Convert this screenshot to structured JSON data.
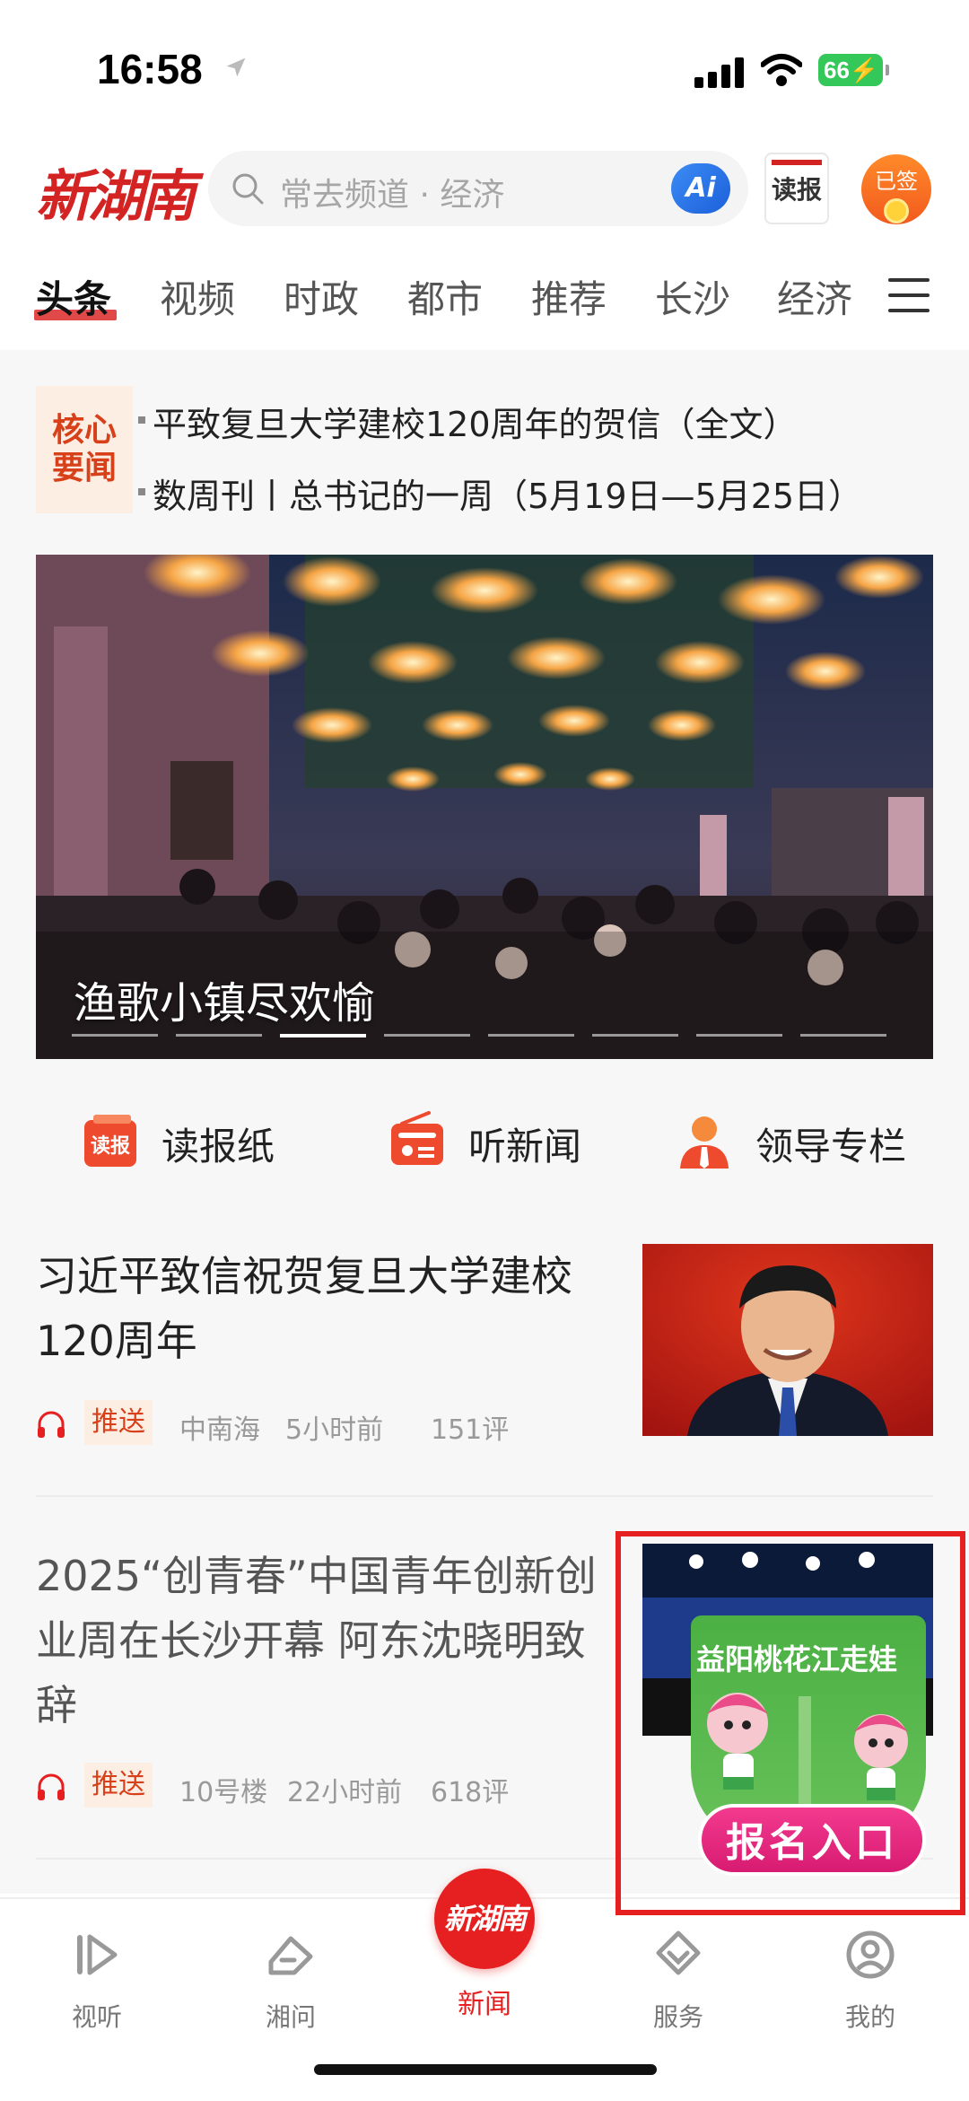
{
  "status_bar": {
    "time": "16:58",
    "battery": "66"
  },
  "header": {
    "logo_text": "新湖南",
    "search_placeholder": "常去频道 · 经济",
    "ai_label": "Ai",
    "read_paper_label": "读报",
    "signin_label": "已签"
  },
  "tabs": [
    "头条",
    "视频",
    "时政",
    "都市",
    "推荐",
    "长沙",
    "经济"
  ],
  "key_news": {
    "badge_line1": "核心",
    "badge_line2": "要闻",
    "items": [
      "平致复旦大学建校120周年的贺信（全文）",
      "数周刊丨总书记的一周（5月19日—5月25日）"
    ]
  },
  "banner": {
    "title": "渔歌小镇尽欢愉",
    "slide_count": 8,
    "active_slide": 2
  },
  "quick_entries": [
    {
      "label": "读报纸",
      "icon_text": "读报"
    },
    {
      "label": "听新闻"
    },
    {
      "label": "领导专栏"
    }
  ],
  "news": [
    {
      "title": "习近平致信祝贺复旦大学建校120周年",
      "tag": "推送",
      "source": "中南海",
      "age": "5小时前",
      "comments": "151评"
    },
    {
      "title": "2025“创青春”中国青年创新创业周在长沙开幕 阿东沈晓明致辞",
      "tag": "推送",
      "source": "10号楼",
      "age": "22小时前",
      "comments": "618评"
    }
  ],
  "promo": {
    "title": "益阳桃花江走娃",
    "button": "报名入口"
  },
  "bottom_nav": {
    "items": [
      "视听",
      "湘问",
      "新闻",
      "服务",
      "我的"
    ],
    "center_logo": "新湖南"
  },
  "colors": {
    "accent": "#e62020",
    "tag_bg": "#fdeee4",
    "tag_text": "#d8401a",
    "feed_bg": "#f7f7f7"
  }
}
